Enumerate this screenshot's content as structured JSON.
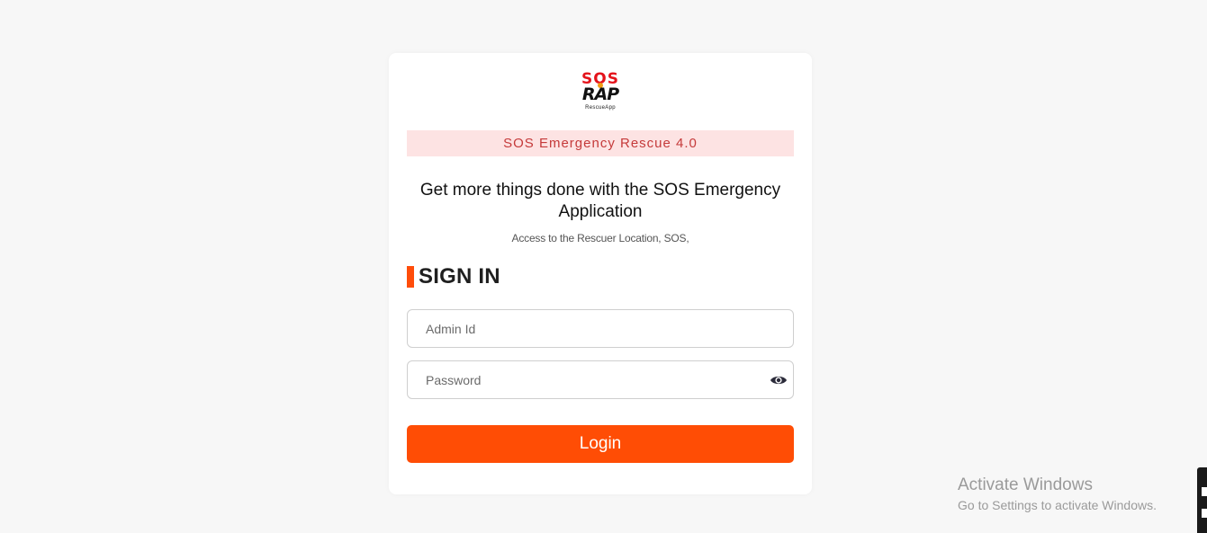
{
  "logo": {
    "top_text": "SOS",
    "main_text": "RAP",
    "sub_text": "RescueApp",
    "colors": {
      "sos": "#e4131b",
      "rap": "#111111"
    }
  },
  "banner": {
    "text": "SOS Emergency Rescue 4.0"
  },
  "headline": {
    "text": "Get more things done with the SOS Emergency Application"
  },
  "subline": {
    "text": "Access to the Rescuer Location, SOS,"
  },
  "signin": {
    "title": "SIGN IN"
  },
  "form": {
    "admin_id_placeholder": "Admin Id",
    "admin_id_value": "",
    "password_placeholder": "Password",
    "password_value": "",
    "password_toggle_icon": "eye-icon",
    "login_label": "Login"
  },
  "watermark": {
    "title": "Activate Windows",
    "subtitle": "Go to Settings to activate Windows."
  },
  "colors": {
    "accent": "#ff4d05",
    "banner_bg": "#fde3e3",
    "banner_text": "#c53a3a",
    "page_bg": "#f7f7f7"
  }
}
